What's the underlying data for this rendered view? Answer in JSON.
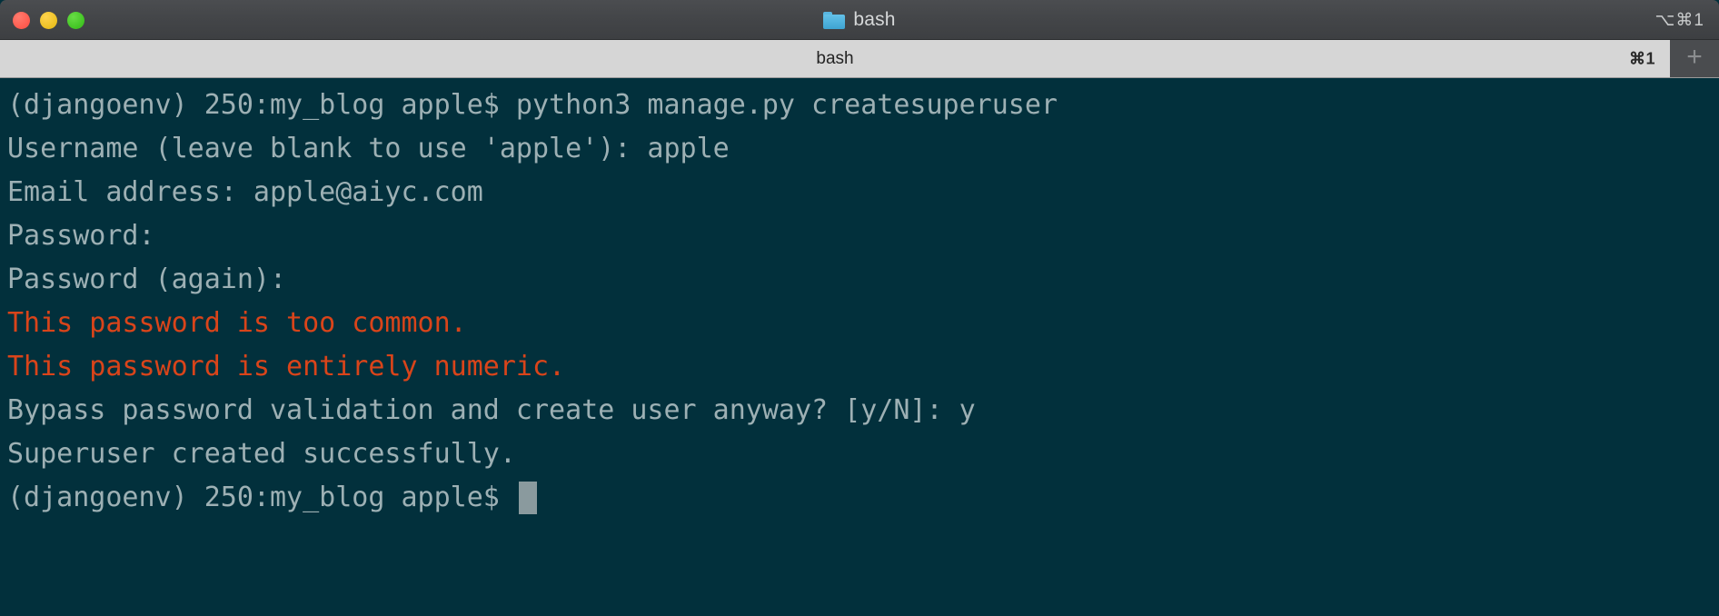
{
  "window": {
    "title": "bash",
    "title_icon": "folder-icon",
    "shortcut": "⌥⌘1",
    "traffic_lights": {
      "close": "close-button",
      "minimize": "minimize-button",
      "maximize": "maximize-button"
    }
  },
  "tabbar": {
    "tab_label": "bash",
    "tab_shortcut": "⌘1",
    "new_tab_label": "+"
  },
  "terminal": {
    "background_color": "#02303c",
    "foreground_color": "#9db0b4",
    "error_color": "#d9441a",
    "cursor_color": "#8a9a9e",
    "lines": [
      {
        "text": "(djangoenv) 250:my_blog apple$ python3 manage.py createsuperuser",
        "type": "normal"
      },
      {
        "text": "Username (leave blank to use 'apple'): apple",
        "type": "normal"
      },
      {
        "text": "Email address: apple@aiyc.com",
        "type": "normal"
      },
      {
        "text": "Password:",
        "type": "normal"
      },
      {
        "text": "Password (again):",
        "type": "normal"
      },
      {
        "text": "This password is too common.",
        "type": "error"
      },
      {
        "text": "This password is entirely numeric.",
        "type": "error"
      },
      {
        "text": "Bypass password validation and create user anyway? [y/N]: y",
        "type": "normal"
      },
      {
        "text": "Superuser created successfully.",
        "type": "normal"
      }
    ],
    "prompt": "(djangoenv) 250:my_blog apple$ "
  }
}
